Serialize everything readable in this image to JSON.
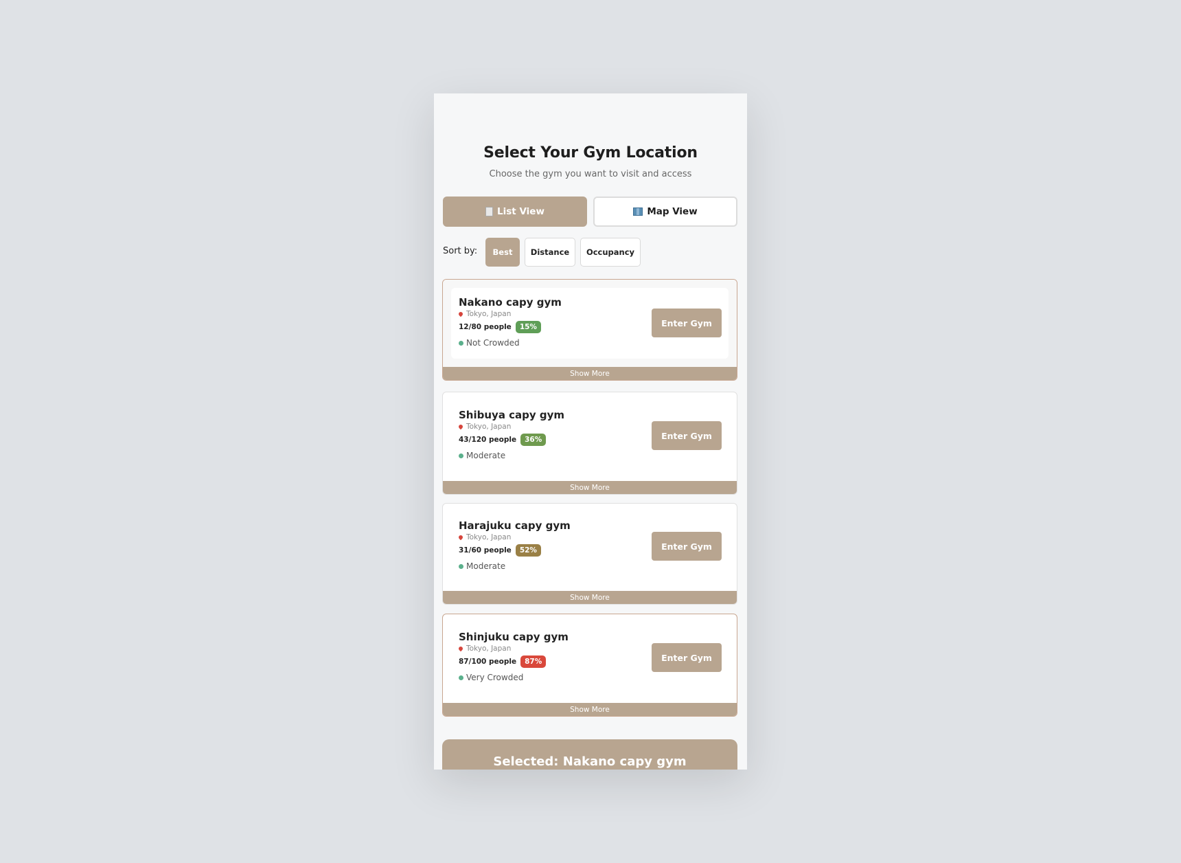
{
  "header": {
    "title": "Select Your Gym Location",
    "subtitle": "Choose the gym you want to visit and access"
  },
  "view_toggle": {
    "list_label": "List View",
    "map_label": "Map View",
    "active": "list"
  },
  "sort": {
    "label": "Sort by:",
    "options": [
      "Best",
      "Distance",
      "Occupancy"
    ],
    "selected": "Best"
  },
  "gyms": [
    {
      "name": "Nakano capy gym",
      "location": "Tokyo, Japan",
      "people": "12/80 people",
      "percent": "15%",
      "status": "Not Crowded",
      "badge_color": "#5f9e57",
      "enter_label": "Enter Gym",
      "show_more": "Show More"
    },
    {
      "name": "Shibuya capy gym",
      "location": "Tokyo, Japan",
      "people": "43/120 people",
      "percent": "36%",
      "status": "Moderate",
      "badge_color": "#6f9a4e",
      "enter_label": "Enter Gym",
      "show_more": "Show More"
    },
    {
      "name": "Harajuku capy gym",
      "location": "Tokyo, Japan",
      "people": "31/60 people",
      "percent": "52%",
      "status": "Moderate",
      "badge_color": "#9a8046",
      "enter_label": "Enter Gym",
      "show_more": "Show More"
    },
    {
      "name": "Shinjuku capy gym",
      "location": "Tokyo, Japan",
      "people": "87/100 people",
      "percent": "87%",
      "status": "Very Crowded",
      "badge_color": "#d9483b",
      "enter_label": "Enter Gym",
      "show_more": "Show More"
    }
  ],
  "selected_bar": {
    "text": "Selected: Nakano capy gym"
  },
  "colors": {
    "accent": "#b8a590",
    "status_dot": "#5bb08c"
  }
}
